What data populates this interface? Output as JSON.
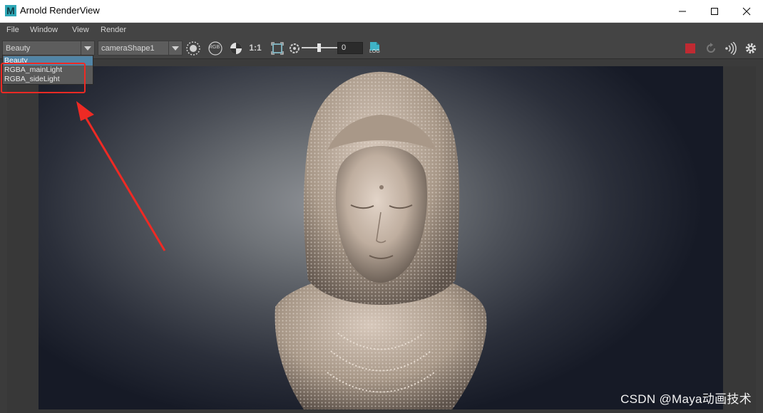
{
  "window": {
    "app_icon_letter": "M",
    "title": "Arnold RenderView"
  },
  "menu": {
    "items": [
      "File",
      "Window",
      "View",
      "Render"
    ]
  },
  "toolbar": {
    "aov_selected": "Beauty",
    "camera_selected": "cameraShape1",
    "rgb_label": "RGB",
    "zoom_label": "1:1",
    "exposure_value": "0",
    "log_label": "LOG"
  },
  "aov_dropdown": {
    "options": [
      "Beauty",
      "RGBA_mainLight",
      "RGBA_sideLight"
    ],
    "selected_index": 0
  },
  "colors": {
    "menu_bg": "#444444",
    "selection": "#5285a6",
    "annotation": "#ee2a24",
    "stop_button": "#c02a32"
  },
  "watermark": "CSDN @Maya动画技术"
}
